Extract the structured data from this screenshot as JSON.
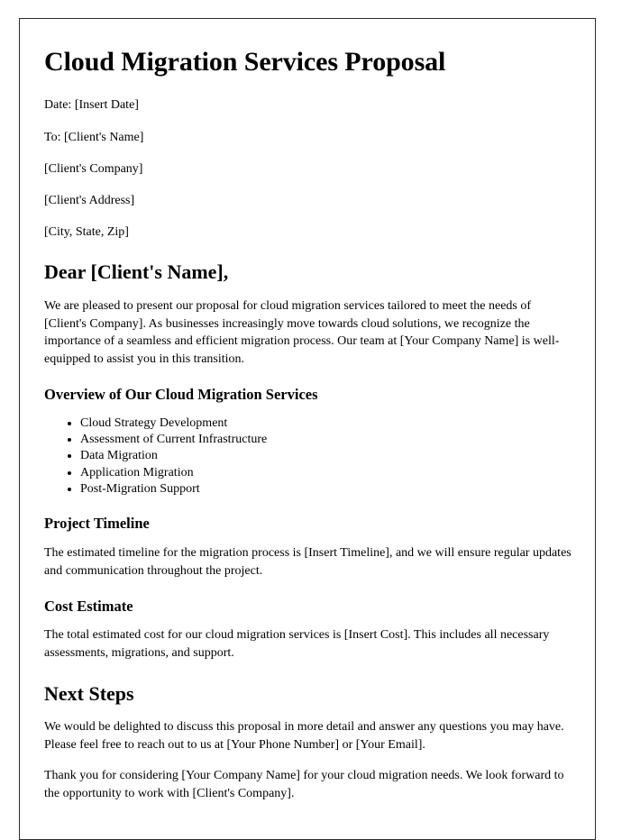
{
  "document": {
    "title": "Cloud Migration Services Proposal",
    "meta": [
      {
        "label": "Date: [Insert Date]"
      },
      {
        "label": "To: [Client's Name]"
      },
      {
        "label": "[Client's Company]"
      },
      {
        "label": "[Client's Address]"
      },
      {
        "label": "[City, State, Zip]"
      }
    ],
    "salutation": "Dear [Client's Name],",
    "intro_paragraph": "We are pleased to present our proposal for cloud migration services tailored to meet the needs of [Client's Company]. As businesses increasingly move towards cloud solutions, we recognize the importance of a seamless and efficient migration process. Our team at [Your Company Name] is well-equipped to assist you in this transition.",
    "overview": {
      "heading": "Overview of Our Cloud Migration Services",
      "items": [
        "Cloud Strategy Development",
        "Assessment of Current Infrastructure",
        "Data Migration",
        "Application Migration",
        "Post-Migration Support"
      ]
    },
    "timeline": {
      "heading": "Project Timeline",
      "paragraph": "The estimated timeline for the migration process is [Insert Timeline], and we will ensure regular updates and communication throughout the project."
    },
    "cost": {
      "heading": "Cost Estimate",
      "paragraph": "The total estimated cost for our cloud migration services is [Insert Cost]. This includes all necessary assessments, migrations, and support."
    },
    "next_steps": {
      "heading": "Next Steps",
      "paragraph_1": "We would be delighted to discuss this proposal in more detail and answer any questions you may have. Please feel free to reach out to us at [Your Phone Number] or [Your Email].",
      "paragraph_2": "Thank you for considering [Your Company Name] for your cloud migration needs. We look forward to the opportunity to work with [Client's Company]."
    }
  }
}
